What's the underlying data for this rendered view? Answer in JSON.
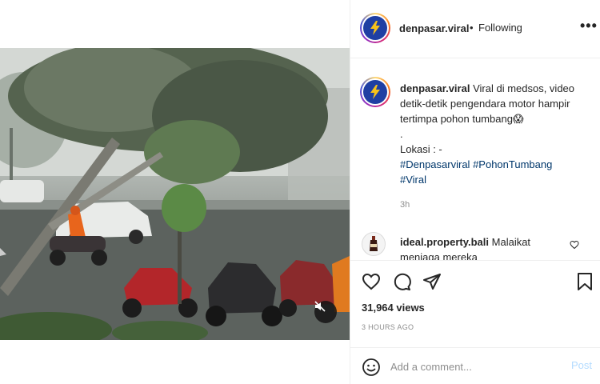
{
  "post": {
    "username": "denpasar.viral",
    "separator": "•",
    "follow_status": "Following",
    "more_label": "•••"
  },
  "caption": {
    "username": "denpasar.viral",
    "text_line1": "Viral di medsos, video detik-detik pengendara motor hampir tertimpa pohon tumbang",
    "emoji": "😱",
    "dot": ".",
    "location": "Lokasi : -",
    "hashtag1": "#Denpasarviral",
    "hashtag2": "#PohonTumbang",
    "hashtag3": "#Viral",
    "time": "3h"
  },
  "comment": {
    "username": "ideal.property.bali",
    "text": "Malaikat menjaga mereka"
  },
  "stats": {
    "views": "31,964 views",
    "posted": "3 HOURS AGO"
  },
  "add_comment": {
    "placeholder": "Add a comment...",
    "post_label": "Post"
  },
  "icons": {
    "avatar": "lightning-bolt-icon",
    "mute": "muted-speaker-icon",
    "like": "heart-icon",
    "comment": "comment-bubble-icon",
    "share": "paper-plane-icon",
    "save": "bookmark-icon",
    "emoji": "smiley-icon"
  },
  "colors": {
    "brand_avatar": "#1f3fa3",
    "bolt": "#f7c21b",
    "hashtag": "#00376b",
    "post_button": "#b3dbff"
  }
}
